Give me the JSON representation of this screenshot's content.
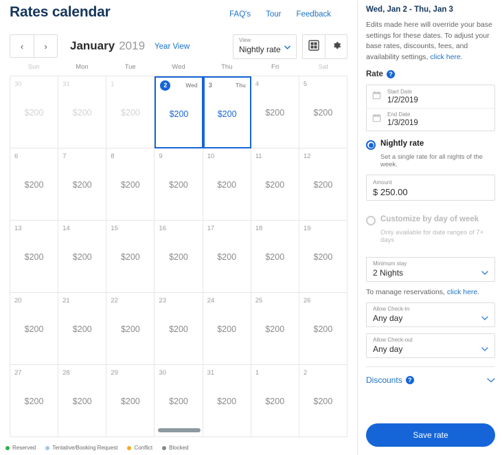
{
  "header": {
    "title": "Rates calendar",
    "links": [
      {
        "label": "FAQ's",
        "name": "faqs-link"
      },
      {
        "label": "Tour",
        "name": "tour-link"
      },
      {
        "label": "Feedback",
        "name": "feedback-link"
      }
    ]
  },
  "controls": {
    "prev_label": "‹",
    "next_label": "›",
    "month": "January",
    "year": "2019",
    "year_view_label": "Year View",
    "view_select": {
      "label": "View",
      "value": "Nightly rate"
    },
    "grid_icon": "grid-view-icon",
    "settings_icon": "gear-icon"
  },
  "calendar": {
    "day_headers": [
      "Sun",
      "Mon",
      "Tue",
      "Wed",
      "Thu",
      "Fri",
      "Sat"
    ],
    "weeks": [
      [
        {
          "day": "30",
          "price": "$200",
          "out": true
        },
        {
          "day": "31",
          "price": "$200",
          "out": true
        },
        {
          "day": "1",
          "price": "$200",
          "out": true
        },
        {
          "day": "2",
          "price": "$200",
          "selected": true,
          "badge": true,
          "dow": "Wed"
        },
        {
          "day": "3",
          "price": "$200",
          "selected": true,
          "dow": "Thu"
        },
        {
          "day": "4",
          "price": "$200"
        },
        {
          "day": "5",
          "price": "$200"
        }
      ],
      [
        {
          "day": "6",
          "price": "$200"
        },
        {
          "day": "7",
          "price": "$200"
        },
        {
          "day": "8",
          "price": "$200"
        },
        {
          "day": "9",
          "price": "$200"
        },
        {
          "day": "10",
          "price": "$200"
        },
        {
          "day": "11",
          "price": "$200"
        },
        {
          "day": "12",
          "price": "$200"
        }
      ],
      [
        {
          "day": "13",
          "price": "$200"
        },
        {
          "day": "14",
          "price": "$200"
        },
        {
          "day": "15",
          "price": "$200"
        },
        {
          "day": "16",
          "price": "$200"
        },
        {
          "day": "17",
          "price": "$200"
        },
        {
          "day": "18",
          "price": "$200"
        },
        {
          "day": "19",
          "price": "$200"
        }
      ],
      [
        {
          "day": "20",
          "price": "$200"
        },
        {
          "day": "21",
          "price": "$200"
        },
        {
          "day": "22",
          "price": "$200"
        },
        {
          "day": "23",
          "price": "$200"
        },
        {
          "day": "24",
          "price": "$200"
        },
        {
          "day": "25",
          "price": "$200"
        },
        {
          "day": "26",
          "price": "$200"
        }
      ],
      [
        {
          "day": "27",
          "price": "$200"
        },
        {
          "day": "28",
          "price": "$200"
        },
        {
          "day": "29",
          "price": "$200"
        },
        {
          "day": "30",
          "price": "$200"
        },
        {
          "day": "31",
          "price": "$200"
        },
        {
          "day": "1",
          "price": "$200"
        },
        {
          "day": "2",
          "price": "$200"
        }
      ]
    ]
  },
  "legend": [
    {
      "label": "Reserved",
      "color": "#2bb24c"
    },
    {
      "label": "Tentative/Booking Request",
      "color": "#a7c4e5"
    },
    {
      "label": "Conflict",
      "color": "#f0ad1e"
    },
    {
      "label": "Blocked",
      "color": "#7e8a90"
    }
  ],
  "panel": {
    "title": "Wed, Jan 2 - Thu, Jan 3",
    "description_before": "Edits made here will override your base settings for these dates. To adjust your base rates, discounts, fees, and availability settings, ",
    "description_link": "click here",
    "description_after": ".",
    "rate_section_label": "Rate",
    "help_glyph": "?",
    "start_date": {
      "label": "Start Date",
      "value": "1/2/2019",
      "icon": "calendar-icon"
    },
    "end_date": {
      "label": "End Date",
      "value": "1/3/2019",
      "icon": "calendar-icon"
    },
    "nightly_rate": {
      "label": "Nightly rate",
      "sub": "Set a single rate for all nights of the week.",
      "selected": true
    },
    "amount": {
      "label": "Amount",
      "value": "$ 250.00"
    },
    "customize": {
      "label": "Customize by day of week",
      "sub": "Only available for date ranges of 7+ days",
      "selected": false
    },
    "minimum_stay": {
      "label": "Minimum stay",
      "value": "2 Nights"
    },
    "manage_note_before": "To manage reservations, ",
    "manage_note_link": "click here",
    "manage_note_after": ".",
    "allow_checkin": {
      "label": "Allow Check-In",
      "value": "Any day"
    },
    "allow_checkout": {
      "label": "Allow Check-out",
      "value": "Any day"
    },
    "discounts_label": "Discounts",
    "save_label": "Save rate"
  },
  "colors": {
    "accent": "#1565d8",
    "link": "#1a73c7",
    "title": "#14365d"
  }
}
